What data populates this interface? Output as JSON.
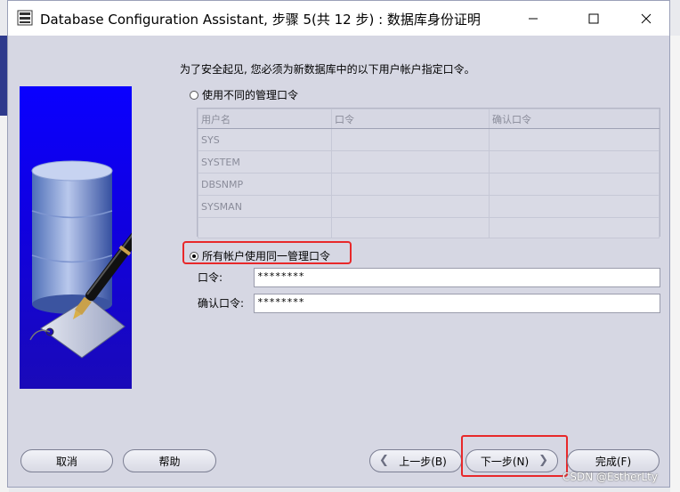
{
  "window": {
    "title": "Database Configuration Assistant, 步骤 5(共 12 步) : 数据库身份证明"
  },
  "intro_text": "为了安全起见, 您必须为新数据库中的以下用户帐户指定口令。",
  "option_different": {
    "label": "使用不同的管理口令",
    "selected": false
  },
  "accounts_table": {
    "headers": [
      "用户名",
      "口令",
      "确认口令"
    ],
    "rows": [
      [
        "SYS",
        "",
        ""
      ],
      [
        "SYSTEM",
        "",
        ""
      ],
      [
        "DBSNMP",
        "",
        ""
      ],
      [
        "SYSMAN",
        "",
        ""
      ]
    ]
  },
  "option_same": {
    "label": "所有帐户使用同一管理口令",
    "selected": true
  },
  "password": {
    "label": "口令:",
    "value": "********"
  },
  "confirm_password": {
    "label": "确认口令:",
    "value": "********"
  },
  "buttons": {
    "cancel": "取消",
    "help": "帮助",
    "back": "上一步(B)",
    "next": "下一步(N)",
    "finish": "完成(F)"
  },
  "colors": {
    "highlight": "#e8282a",
    "banner": "#0a00ff"
  },
  "watermark": "CSDN @EstherLty"
}
